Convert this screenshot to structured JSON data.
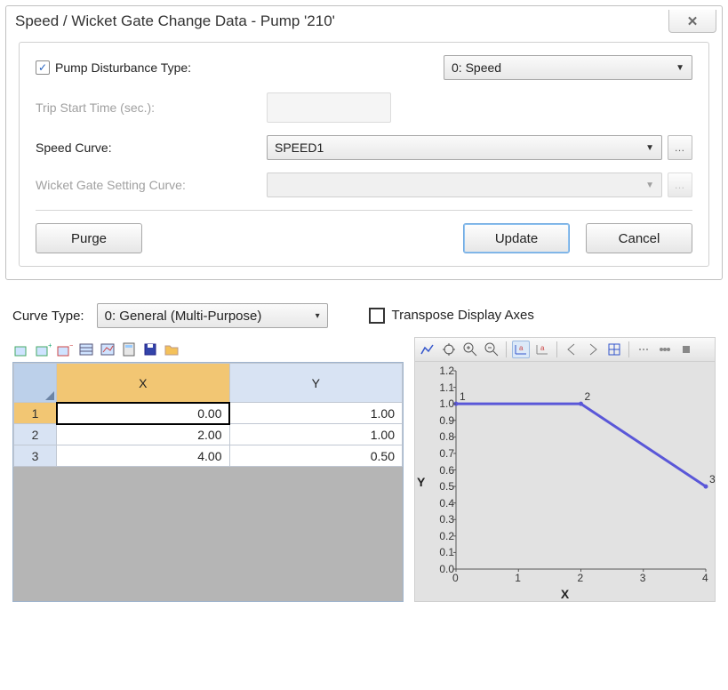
{
  "dialog": {
    "title": "Speed / Wicket Gate Change Data - Pump '210'",
    "close_glyph": "✕",
    "fields": {
      "pump_disturbance_label": "Pump Disturbance Type:",
      "pump_disturbance_checked": true,
      "pump_disturbance_value": "0: Speed",
      "trip_start_label": "Trip Start Time (sec.):",
      "trip_start_value": "",
      "speed_curve_label": "Speed Curve:",
      "speed_curve_value": "SPEED1",
      "wicket_label": "Wicket Gate Setting Curve:",
      "wicket_value": ""
    },
    "buttons": {
      "purge": "Purge",
      "update": "Update",
      "cancel": "Cancel"
    }
  },
  "editor": {
    "curve_type_label": "Curve Type:",
    "curve_type_value": "0: General (Multi-Purpose)",
    "transpose_label": "Transpose Display Axes",
    "transpose_checked": false,
    "columns": {
      "x": "X",
      "y": "Y"
    },
    "rows": [
      {
        "idx": "1",
        "x": "0.00",
        "y": "1.00"
      },
      {
        "idx": "2",
        "x": "2.00",
        "y": "1.00"
      },
      {
        "idx": "3",
        "x": "4.00",
        "y": "0.50"
      }
    ],
    "left_toolbar_icons": [
      "insert-row",
      "append-row",
      "delete-row",
      "table",
      "edit-chart",
      "calc",
      "save",
      "open"
    ],
    "right_toolbar_icons": [
      "chart-line",
      "pan",
      "zoom-in",
      "zoom-out",
      "sep",
      "auto-x",
      "auto-y",
      "sep",
      "prev",
      "next",
      "fit",
      "sep",
      "dots1",
      "dots2",
      "stop"
    ]
  },
  "chart_data": {
    "type": "line",
    "xlabel": "X",
    "ylabel": "Y",
    "x": [
      0,
      2,
      4
    ],
    "y": [
      1.0,
      1.0,
      0.5
    ],
    "point_labels": [
      "1",
      "2",
      "3"
    ],
    "xlim": [
      0,
      4
    ],
    "ylim": [
      0.0,
      1.2
    ],
    "xticks": [
      0,
      1,
      2,
      3,
      4
    ],
    "yticks": [
      0.0,
      0.1,
      0.2,
      0.3,
      0.4,
      0.5,
      0.6,
      0.7,
      0.8,
      0.9,
      1.0,
      1.1,
      1.2
    ],
    "line_color": "#5a57d8"
  }
}
